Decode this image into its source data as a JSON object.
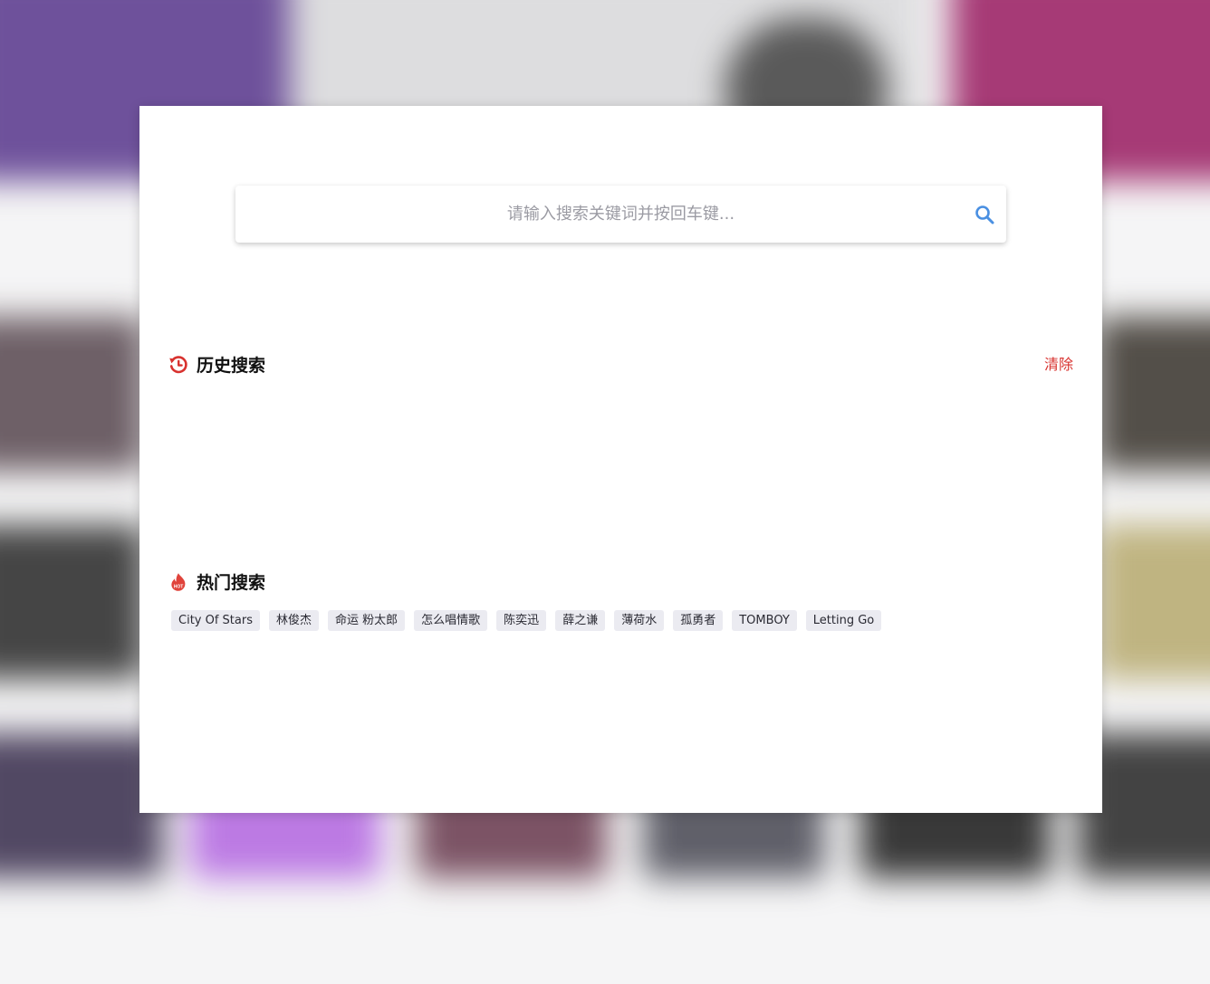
{
  "search": {
    "placeholder": "请输入搜索关键词并按回车键...",
    "value": ""
  },
  "history": {
    "title": "历史搜索",
    "clear_label": "清除",
    "items": []
  },
  "hot": {
    "title": "热门搜索",
    "icon_badge": "HOT",
    "tags": [
      "City Of Stars",
      "林俊杰",
      "命运 粉太郎",
      "怎么唱情歌",
      "陈奕迅",
      "薛之谦",
      "薄荷水",
      "孤勇者",
      "TOMBOY",
      "Letting Go"
    ]
  },
  "colors": {
    "accent_red": "#d8322f",
    "search_icon": "#4a90e2",
    "tag_bg": "#ebebf1"
  }
}
